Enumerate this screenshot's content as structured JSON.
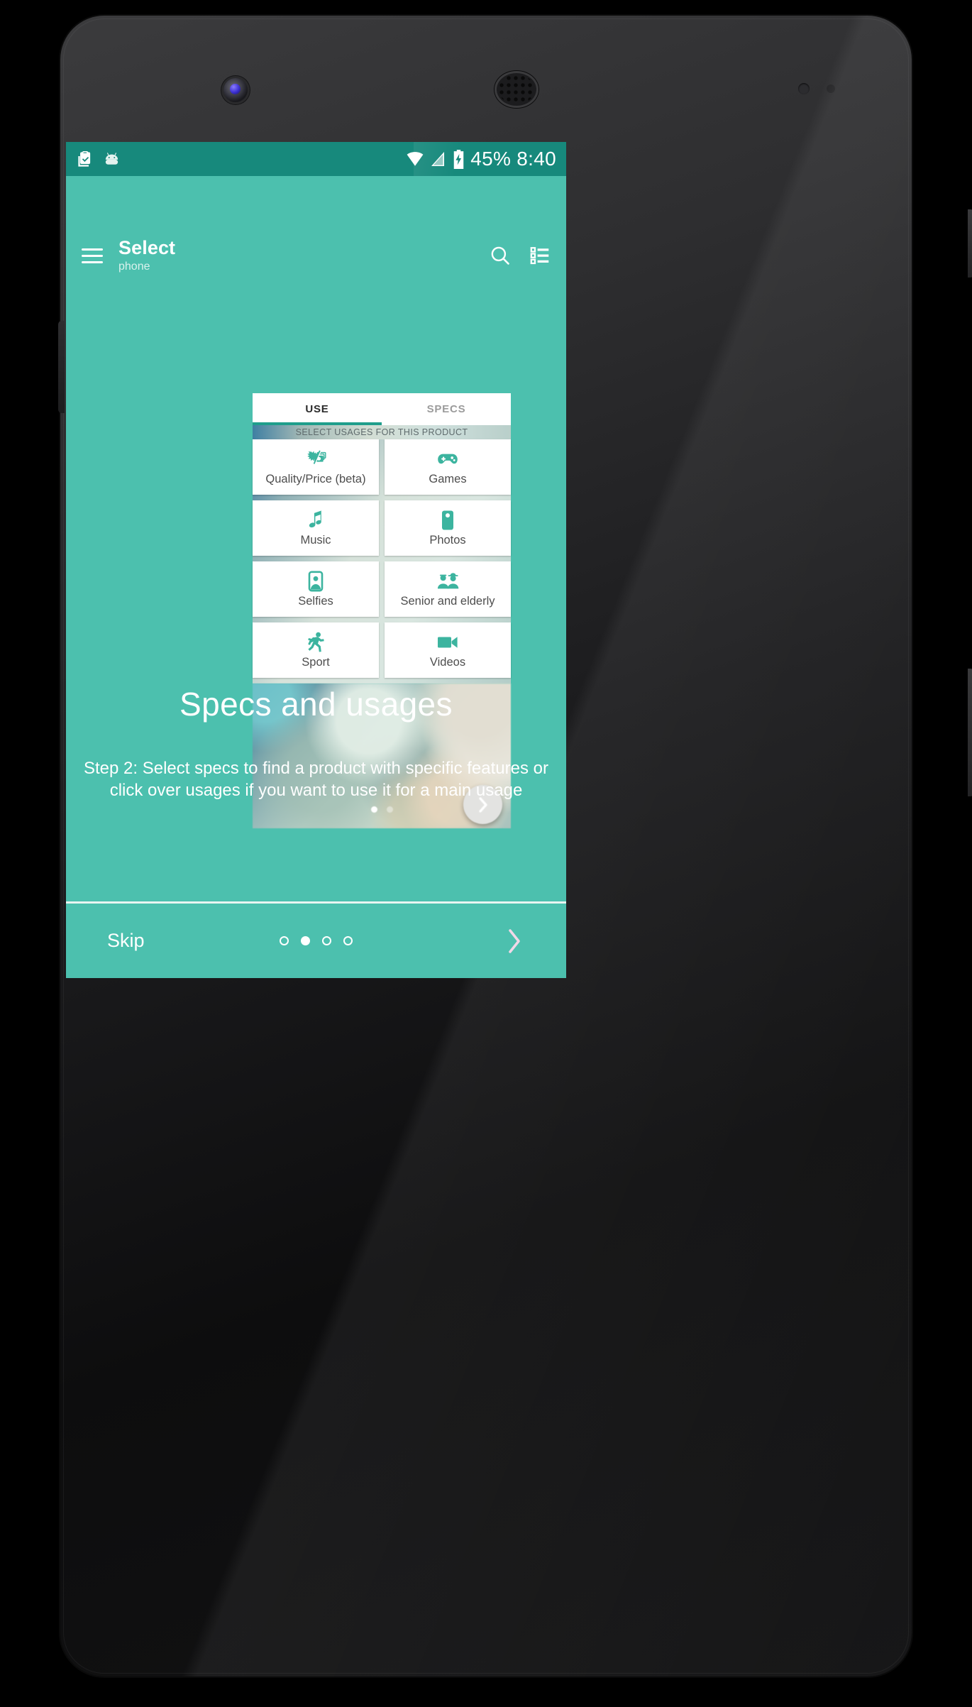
{
  "statusbar": {
    "left_icons": [
      "clipboard-check-icon",
      "android-head-icon"
    ],
    "right_icons": [
      "wifi-icon",
      "cell-signal-icon",
      "battery-charging-icon"
    ],
    "battery_percent": "45%",
    "time": "8:40",
    "battery_and_time": "45% 8:40",
    "background": "#17897c"
  },
  "appbar": {
    "menu_icon": "hamburger-menu-icon",
    "title": "Select",
    "subtitle": "phone",
    "search_icon": "search-icon",
    "list_icon": "list-view-icon"
  },
  "panel": {
    "tabs": [
      {
        "label": "USE",
        "active": true
      },
      {
        "label": "SPECS",
        "active": false
      }
    ],
    "banner": "SELECT USAGES FOR THIS PRODUCT",
    "cards": [
      {
        "label": "Quality/Price (beta)",
        "icon": "money-quality-price-icon"
      },
      {
        "label": "Games",
        "icon": "gamepad-icon"
      },
      {
        "label": "Music",
        "icon": "music-note-icon"
      },
      {
        "label": "Photos",
        "icon": "camera-phone-icon"
      },
      {
        "label": "Selfies",
        "icon": "portrait-selfie-icon"
      },
      {
        "label": "Senior and elderly",
        "icon": "two-people-icon"
      },
      {
        "label": "Sport",
        "icon": "running-person-icon"
      },
      {
        "label": "Videos",
        "icon": "video-camera-icon"
      }
    ],
    "carousel": {
      "dots_total": 2,
      "dot_active_index": 0,
      "next_icon": "chevron-right-icon"
    }
  },
  "onboarding": {
    "title": "Specs and usages",
    "description": "Step 2: Select specs to find a product with specific features or click over usages if you want to use it for a main usage"
  },
  "bottombar": {
    "skip_label": "Skip",
    "dots_total": 4,
    "dot_active_index": 1,
    "next_icon": "chevron-right-icon"
  },
  "colors": {
    "accent_teal": "#4cc0ae",
    "statusbar_teal": "#17897c",
    "icon_teal": "#3cb49f",
    "tab_underline": "#1f9e8c"
  }
}
